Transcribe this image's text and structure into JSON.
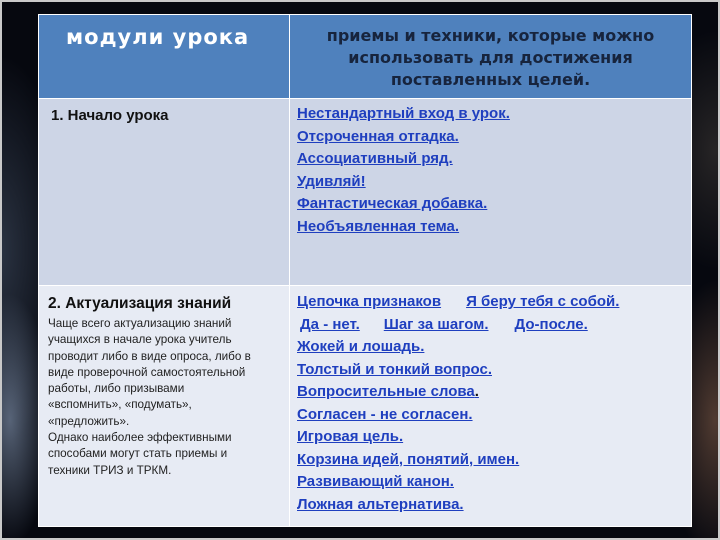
{
  "table": {
    "header": {
      "col1": "модули урока",
      "col2_lines": [
        "приемы и техники, которые можно",
        "использовать для достижения",
        "поставленных целей."
      ]
    },
    "rows": [
      {
        "module": "1. Начало урока",
        "description": [],
        "techniques": [
          "Нестандартный вход в урок.",
          "Отсроченная отгадка.",
          "Ассоциативный ряд.",
          "Удивляй!",
          "Фантастическая добавка.",
          "Необъявленная тема."
        ]
      },
      {
        "module": "2. Актуализация знаний",
        "description": [
          "Чаще всего актуализацию знаний",
          "учащихся в начале урока учитель",
          "проводит либо в виде опроса, либо в",
          "виде проверочной самостоятельной",
          "работы, либо призывами",
          "«вспомнить», «подумать»,",
          "«предложить».",
          "Однако наиболее эффективными",
          "способами могут стать приемы и",
          "техники ТРИЗ и ТРКМ."
        ],
        "techniques_row_1": [
          "Цепочка признаков",
          "Я беру тебя с собой."
        ],
        "techniques_row_2": [
          "Да - нет.",
          "Шаг за шагом.",
          "До-после."
        ],
        "techniques": [
          "Жокей и лошадь.",
          "Толстый и тонкий вопрос.",
          "Вопросительные слова",
          "Согласен - не согласен.",
          "Игровая цель.",
          "Корзина идей, понятий, имен.",
          "Развивающий канон.",
          "Ложная альтернатива."
        ],
        "trailing_dot": "."
      }
    ]
  },
  "colors": {
    "header_bg": "#4f81bd",
    "row1_bg": "#cdd5e6",
    "row2_bg": "#e7ebf4",
    "link_blue": "#1f3fbf"
  }
}
